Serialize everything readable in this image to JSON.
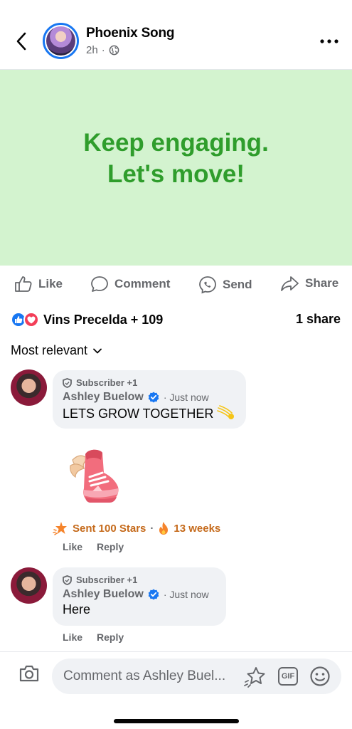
{
  "header": {
    "author": "Phoenix Song",
    "time": "2h",
    "separator": "·"
  },
  "post": {
    "line1": "Keep engaging.",
    "line2": "Let's move!",
    "bg_color": "#d3f3cf",
    "text_color": "#2f9d2c"
  },
  "actions": {
    "like": "Like",
    "comment": "Comment",
    "send": "Send",
    "share": "Share"
  },
  "reactions": {
    "summary": "Vins Precelda + 109",
    "shares": "1 share"
  },
  "sort": {
    "label": "Most relevant"
  },
  "comments": [
    {
      "badge": "Subscriber +1",
      "name": "Ashley Buelow",
      "time": "Just now",
      "text": "LETS GROW TOGETHER",
      "like": "Like",
      "reply": "Reply"
    },
    {
      "badge": "Subscriber +1",
      "name": "Ashley Buelow",
      "time": "Just now",
      "text": "Here",
      "like": "Like",
      "reply": "Reply"
    }
  ],
  "stars": {
    "sent": "Sent 100 Stars",
    "dot": "·",
    "streak": "13 weeks"
  },
  "composer": {
    "placeholder": "Comment as Ashley Buel...",
    "gif": "GIF"
  },
  "colors": {
    "accent": "#1877f2",
    "love": "#f33e58",
    "stars": "#c56a1b"
  }
}
